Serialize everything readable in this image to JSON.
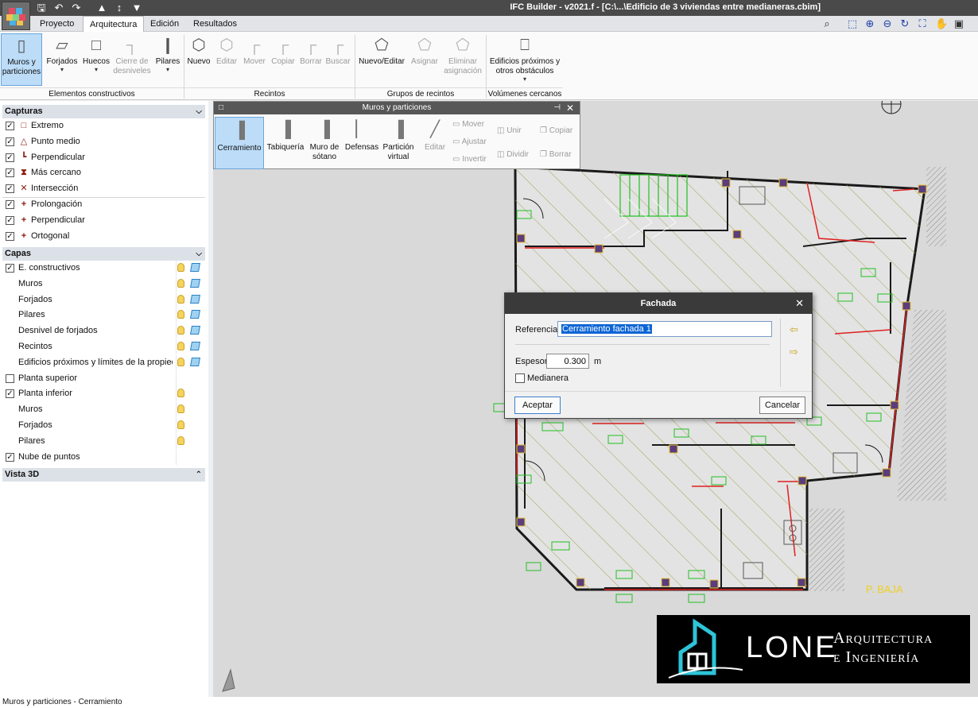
{
  "titlebar": {
    "title": "IFC Builder - v2021.f - [C:\\...\\Edificio de 3 viviendas entre medianeras.cbim]"
  },
  "quick_access": [
    "save-icon",
    "undo-icon",
    "redo-icon",
    "arrow-up-icon",
    "level-selector-icon",
    "arrow-down-icon"
  ],
  "menu": {
    "tabs": [
      "Proyecto",
      "Arquitectura",
      "Edición",
      "Resultados"
    ],
    "active_tab": "Arquitectura"
  },
  "right_tools": [
    "search-icon",
    "zoom-window-icon",
    "zoom-in-icon",
    "zoom-out-icon",
    "refresh-icon",
    "zoom-extents-icon",
    "pan-hand-icon",
    "window-icon"
  ],
  "ribbon": {
    "buttons": {
      "muros": "Muros y particiones",
      "forjados": "Forjados",
      "huecos": "Huecos",
      "cierre": "Cierre de desniveles",
      "pilares": "Pilares",
      "nuevo": "Nuevo",
      "editar": "Editar",
      "mover": "Mover",
      "copiar": "Copiar",
      "borrar": "Borrar",
      "buscar": "Buscar",
      "nuevo_editar": "Nuevo/Editar",
      "asignar": "Asignar",
      "eliminar": "Eliminar asignación",
      "edificios": "Edificios próximos y otros obstáculos"
    },
    "groups": {
      "elementos": "Elementos constructivos",
      "recintos": "Recintos",
      "grupos": "Grupos de recintos",
      "volumenes": "Volúmenes cercanos"
    }
  },
  "left_panel": {
    "capturas_title": "Capturas",
    "capturas": [
      {
        "label": "Extremo",
        "checked": true,
        "icon": "endpoint-square-icon"
      },
      {
        "label": "Punto medio",
        "checked": true,
        "icon": "midpoint-triangle-icon"
      },
      {
        "label": "Perpendicular",
        "checked": true,
        "icon": "perpendicular-icon"
      },
      {
        "label": "Más cercano",
        "checked": true,
        "icon": "nearest-hourglass-icon"
      },
      {
        "label": "Intersección",
        "checked": true,
        "icon": "intersection-x-icon"
      },
      {
        "label": "Prolongación",
        "checked": true,
        "icon": "plus-icon"
      },
      {
        "label": "Perpendicular",
        "checked": true,
        "icon": "plus-icon"
      },
      {
        "label": "Ortogonal",
        "checked": true,
        "icon": "plus-icon"
      }
    ],
    "capas_title": "Capas",
    "capas": [
      {
        "label": "E. constructivos",
        "checkbox": true,
        "checked": true,
        "bulb": true,
        "cube": true
      },
      {
        "label": "Muros",
        "checkbox": false,
        "bulb": true,
        "cube": true
      },
      {
        "label": "Forjados",
        "checkbox": false,
        "bulb": true,
        "cube": true,
        "locked": true
      },
      {
        "label": "Pilares",
        "checkbox": false,
        "bulb": true,
        "cube": true
      },
      {
        "label": "Desnivel de forjados",
        "checkbox": false,
        "bulb": true,
        "cube": true
      },
      {
        "label": "Recintos",
        "checkbox": false,
        "bulb": true,
        "cube": true
      },
      {
        "label": "Edificios próximos y límites de la propiedad",
        "checkbox": false,
        "bulb": true,
        "cube": true
      },
      {
        "label": "Planta superior",
        "checkbox": true,
        "checked": false,
        "bulb": false,
        "cube": false
      },
      {
        "label": "Planta inferior",
        "checkbox": true,
        "checked": true,
        "bulb": true,
        "cube": false
      },
      {
        "label": "Muros",
        "checkbox": false,
        "bulb": true,
        "cube": false
      },
      {
        "label": "Forjados",
        "checkbox": false,
        "bulb": true,
        "cube": false
      },
      {
        "label": "Pilares",
        "checkbox": false,
        "bulb": true,
        "cube": false
      },
      {
        "label": "Nube de puntos",
        "checkbox": true,
        "checked": true,
        "bulb": false,
        "cube": false
      }
    ],
    "vista3d_title": "Vista 3D"
  },
  "floating_panel": {
    "title": "Muros y particiones",
    "buttons": {
      "cerramiento": "Cerramiento",
      "tabiqueria": "Tabiquería",
      "muro_sotano": "Muro de sótano",
      "defensas": "Defensas",
      "particion": "Partición virtual",
      "editar": "Editar"
    },
    "small_actions": {
      "mover": "Mover",
      "ajustar": "Ajustar",
      "invertir": "Invertir",
      "unir": "Unir",
      "dividir": "Dividir",
      "copiar": "Copiar",
      "borrar": "Borrar"
    }
  },
  "dialog": {
    "title": "Fachada",
    "referencia_label": "Referencia",
    "referencia_value": "Cerramiento fachada 1",
    "espesor_label": "Espesor",
    "espesor_value": "0.300",
    "espesor_unit": "m",
    "medianera_label": "Medianera",
    "medianera_checked": false,
    "accept": "Aceptar",
    "cancel": "Cancelar"
  },
  "canvas": {
    "floor_label": "P. BAJA",
    "colors": {
      "walls": "#1a1a1a",
      "red": "#e02020",
      "green": "#22c022",
      "hatch": "#9a9a3a",
      "floor_label": "#f0d020"
    }
  },
  "logo": {
    "brand": "LONE",
    "line1": "Arquitectura",
    "line2": "e Ingeniería"
  },
  "status": {
    "text": "Muros y particiones - Cerramiento"
  },
  "colors": {
    "titlebar": "#4a4a4a",
    "selected_button": "#bcdcf8",
    "dialog_title": "#3a3a3a",
    "canvas_bg": "#d9d9d9",
    "accent_text_select": "#0a64d6"
  }
}
